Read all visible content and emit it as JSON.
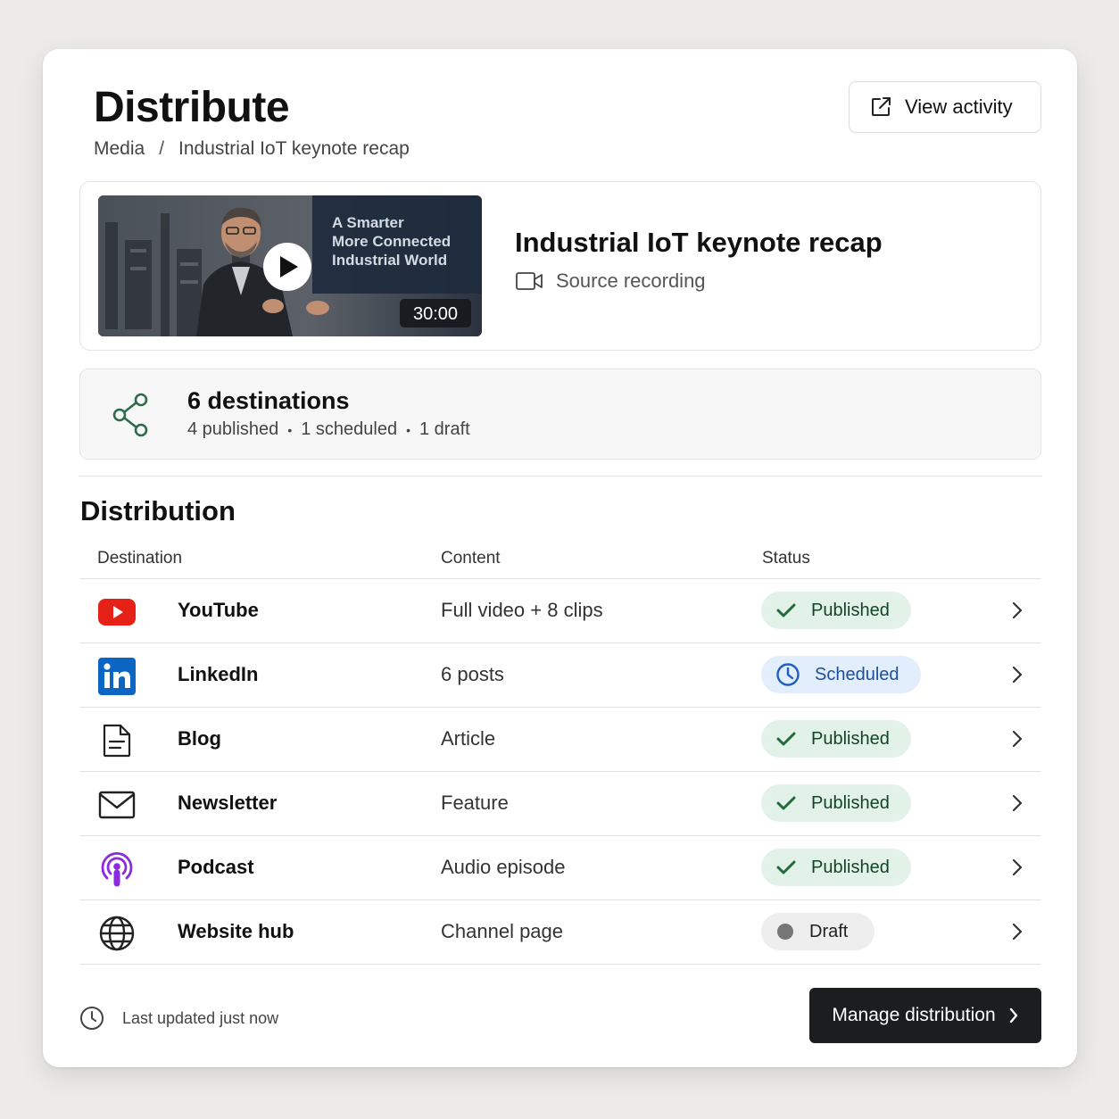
{
  "header": {
    "title": "Distribute",
    "breadcrumb": [
      "Media",
      "Industrial IoT keynote recap"
    ],
    "breadcrumb_separator": "/",
    "view_activity_label": "View activity"
  },
  "media": {
    "title": "Industrial IoT keynote recap",
    "source_label": "Source recording",
    "thumbnail_overlay_text": [
      "A Smarter",
      "More Connected",
      "Industrial World"
    ],
    "duration": "30:00"
  },
  "destinations_summary": {
    "count_label": "6 destinations",
    "published": "4 published",
    "scheduled": "1 scheduled",
    "draft": "1 draft"
  },
  "distribution": {
    "section_title": "Distribution",
    "columns": [
      "Destination",
      "Content",
      "Status"
    ],
    "rows": [
      {
        "destination": "YouTube",
        "icon": "youtube-icon",
        "content": "Full video + 8 clips",
        "status": "Published",
        "status_type": "published"
      },
      {
        "destination": "LinkedIn",
        "icon": "linkedin-icon",
        "content": "6 posts",
        "status": "Scheduled",
        "status_type": "scheduled"
      },
      {
        "destination": "Blog",
        "icon": "document-icon",
        "content": "Article",
        "status": "Published",
        "status_type": "published"
      },
      {
        "destination": "Newsletter",
        "icon": "envelope-icon",
        "content": "Feature",
        "status": "Published",
        "status_type": "published"
      },
      {
        "destination": "Podcast",
        "icon": "podcast-icon",
        "content": "Audio episode",
        "status": "Published",
        "status_type": "published"
      },
      {
        "destination": "Website hub",
        "icon": "globe-icon",
        "content": "Channel page",
        "status": "Draft",
        "status_type": "draft"
      }
    ]
  },
  "footer": {
    "last_updated": "Last updated just now",
    "manage_label": "Manage distribution"
  },
  "colors": {
    "published_bg": "#e3f2e8",
    "published_icon": "#1f6b3a",
    "scheduled_bg": "#e3eefc",
    "scheduled_icon": "#1d5fc0",
    "draft_dot": "#777777",
    "youtube_red": "#e62117",
    "linkedin_blue": "#0a66c2",
    "podcast_purple": "#8a2be2",
    "share_green": "#2e6b4a",
    "primary_button": "#1c1d1f"
  }
}
